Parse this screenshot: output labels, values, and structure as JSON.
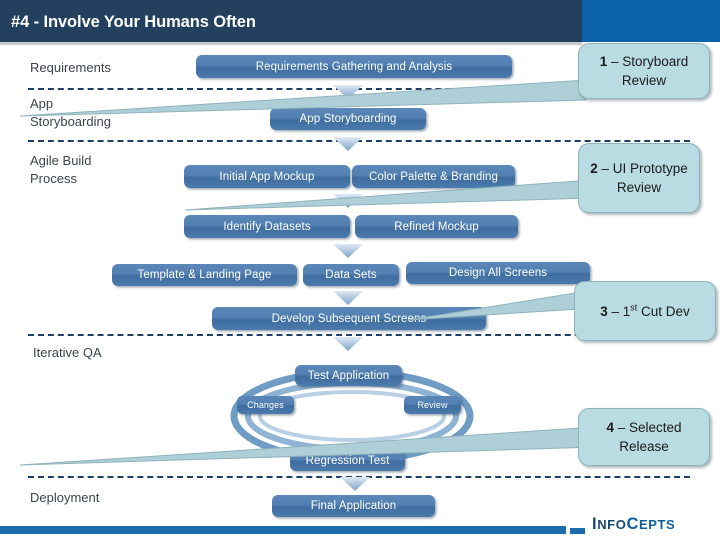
{
  "header": {
    "title": "#4 - Involve Your Humans Often",
    "band_color": "#23415f",
    "accent_color": "#0a62a9"
  },
  "lanes": [
    {
      "id": "requirements",
      "label": "Requirements"
    },
    {
      "id": "app-storyboarding",
      "label": "App\nStoryboarding"
    },
    {
      "id": "agile-build",
      "label": "Agile Build\nProcess"
    },
    {
      "id": "iterative-qa",
      "label": "Iterative QA"
    },
    {
      "id": "deployment",
      "label": "Deployment"
    }
  ],
  "boxes": [
    {
      "id": "requirements-gathering",
      "label": "Requirements Gathering and Analysis"
    },
    {
      "id": "app-storyboarding",
      "label": "App Storyboarding"
    },
    {
      "id": "initial-app-mockup",
      "label": "Initial App Mockup"
    },
    {
      "id": "color-palette-branding",
      "label": "Color Palette & Branding"
    },
    {
      "id": "identify-datasets",
      "label": "Identify Datasets"
    },
    {
      "id": "refined-mockup",
      "label": "Refined Mockup"
    },
    {
      "id": "template-landing-page",
      "label": "Template & Landing Page"
    },
    {
      "id": "data-sets",
      "label": "Data Sets"
    },
    {
      "id": "design-all-screens",
      "label": "Design All Screens"
    },
    {
      "id": "develop-subsequent",
      "label": "Develop Subsequent Screens"
    },
    {
      "id": "test-application",
      "label": "Test Application"
    },
    {
      "id": "changes",
      "label": "Changes"
    },
    {
      "id": "review",
      "label": "Review"
    },
    {
      "id": "regression-test",
      "label": "Regression Test"
    },
    {
      "id": "final-application",
      "label": "Final Application"
    }
  ],
  "callouts": [
    {
      "id": "callout-1",
      "number": "1",
      "dash": " – ",
      "text": "Storyboard Review"
    },
    {
      "id": "callout-2",
      "number": "2",
      "dash": " – ",
      "text": "UI Prototype Review"
    },
    {
      "id": "callout-3",
      "number": "3",
      "dash": " – ",
      "text_pre": "1",
      "text_sup": "st",
      "text_post": " Cut Dev"
    },
    {
      "id": "callout-4",
      "number": "4",
      "dash": " – ",
      "text": "Selected Release"
    }
  ],
  "footer": {
    "logo_info": "I",
    "logo_info_rest": "NFO",
    "logo_cepts": "C",
    "logo_cepts_rest": "EPTS",
    "bar_color": "#1c6cab"
  },
  "colors": {
    "box_fill": "#4b7aac",
    "callout_fill": "#b9dbe2",
    "divider": "#1d3f63",
    "label_text": "#3b444d"
  }
}
